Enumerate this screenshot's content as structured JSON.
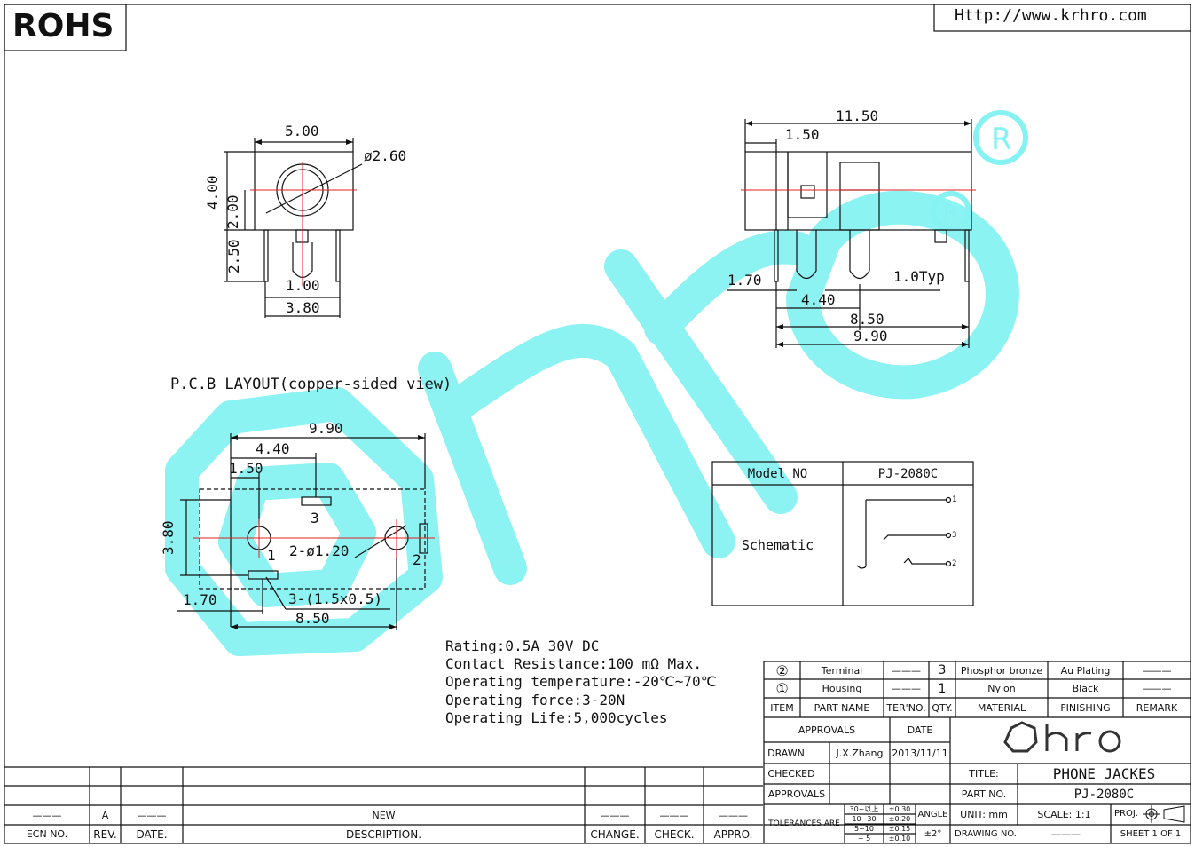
{
  "header": {
    "rohs": "ROHS",
    "url": "Http://www.krhro.com"
  },
  "front_view": {
    "width": "5.00",
    "dia": "ø2.60",
    "height": "4.00",
    "center": "2.00",
    "pin_len": "2.50",
    "pin_pitch": "1.00",
    "pin_span": "3.80"
  },
  "side_view": {
    "length": "11.50",
    "offset": "1.50",
    "pin1": "1.70",
    "pitch": "1.0Typ",
    "d1": "4.40",
    "d2": "8.50",
    "d3": "9.90"
  },
  "pcb": {
    "title": "P.C.B LAYOUT(copper-sided view)",
    "d990": "9.90",
    "d440": "4.40",
    "d150": "1.50",
    "d380": "3.80",
    "d170": "1.70",
    "d850": "8.50",
    "holes": "2-ø1.20",
    "pads": "3-(1.5x0.5)",
    "pin1": "1",
    "pin2": "2",
    "pin3": "3"
  },
  "model_table": {
    "model_label": "Model NO",
    "model_value": "PJ-2080C",
    "schematic_label": "Schematic",
    "pins": [
      "1",
      "3",
      "2"
    ]
  },
  "specs": [
    "Rating:0.5A  30V  DC",
    "Contact  Resistance:100  mΩ  Max.",
    "Operating  temperature:-20℃~70℃",
    "Operating  force:3-20N",
    "Operating  Life:5,000cycles"
  ],
  "bom": {
    "rows": [
      {
        "no": "②",
        "part": "Terminal",
        "ter": "———",
        "qty": "3",
        "material": "Phosphor bronze",
        "finish": "Au Plating",
        "remark": "———"
      },
      {
        "no": "①",
        "part": "Housing",
        "ter": "———",
        "qty": "1",
        "material": "Nylon",
        "finish": "Black",
        "remark": "———"
      }
    ],
    "headers": {
      "item": "ITEM",
      "part": "PART NAME",
      "ter": "TER'NO.",
      "qty": "QTY.",
      "material": "MATERIAL",
      "finish": "FINISHING",
      "remark": "REMARK"
    }
  },
  "title_block": {
    "approvals_header": "APPROVALS",
    "date_header": "DATE",
    "drawn": "DRAWN",
    "drawn_by": "J.X.Zhang",
    "drawn_date": "2013/11/11",
    "checked": "CHECKED",
    "approvals": "APPROVALS",
    "title_label": "TITLE:",
    "title": "PHONE  JACKES",
    "part_no_label": "PART  NO.",
    "part_no": "PJ-2080C",
    "tolerances": "TOLERANCES  ARE",
    "tol_ranges": [
      "30~以上",
      "10~30",
      "5~10",
      "~ 5"
    ],
    "tol_values": [
      "±0.30",
      "±0.20",
      "±0.15",
      "±0.10"
    ],
    "angle": "ANGLE",
    "angle_value": "±2°",
    "unit": "UNIT:  mm",
    "scale": "SCALE:    1:1",
    "proj": "PROJ.",
    "drawing_no": "DRAWING  NO.",
    "drawing_no_value": "———",
    "sheet": "SHEET   1  OF  1",
    "logo": "hro"
  },
  "revision": {
    "row_dash": "———",
    "rev": "A",
    "date_dash": "———",
    "desc": "NEW",
    "headers": {
      "ecn": "ECN  NO.",
      "rev": "REV.",
      "date": "DATE.",
      "desc": "DESCRIPTION.",
      "change": "CHANGE.",
      "check": "CHECK.",
      "appro": "APPRO."
    }
  },
  "colors": {
    "watermark": "#7ff3f3",
    "centerline": "#e02020",
    "ink": "#111111"
  }
}
